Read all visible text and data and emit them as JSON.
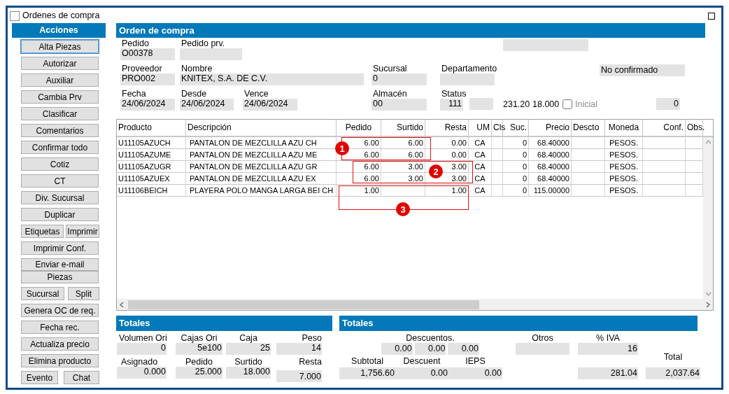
{
  "window": {
    "title": "Ordenes de compra"
  },
  "actions": {
    "title": "Acciones",
    "rows": [
      {
        "kind": "single",
        "buttons": [
          {
            "label": "Alta Piezas",
            "focused": true
          }
        ]
      },
      {
        "kind": "single",
        "buttons": [
          {
            "label": "Autorizar",
            "focused": false
          }
        ]
      },
      {
        "kind": "single",
        "buttons": [
          {
            "label": "Auxiliar",
            "focused": false
          }
        ]
      },
      {
        "kind": "single",
        "buttons": [
          {
            "label": "Cambia Prv",
            "focused": false
          }
        ]
      },
      {
        "kind": "single",
        "buttons": [
          {
            "label": "Clasificar",
            "focused": false
          }
        ]
      },
      {
        "kind": "single",
        "buttons": [
          {
            "label": "Comentarios",
            "focused": false
          }
        ]
      },
      {
        "kind": "single",
        "buttons": [
          {
            "label": "Confirmar todo",
            "focused": false
          }
        ]
      },
      {
        "kind": "single",
        "buttons": [
          {
            "label": "Cotiz",
            "focused": false
          }
        ]
      },
      {
        "kind": "single",
        "buttons": [
          {
            "label": "CT",
            "focused": false
          }
        ]
      },
      {
        "kind": "single",
        "buttons": [
          {
            "label": "Div. Sucursal",
            "focused": false
          }
        ]
      },
      {
        "kind": "single",
        "buttons": [
          {
            "label": "Duplicar",
            "focused": false
          }
        ]
      },
      {
        "kind": "pair",
        "buttons": [
          {
            "label": "Etiquetas",
            "focused": false
          },
          {
            "label": "Imprimir",
            "focused": false
          }
        ]
      },
      {
        "kind": "single",
        "buttons": [
          {
            "label": "Imprimir Conf.",
            "focused": false
          }
        ]
      },
      {
        "kind": "stack",
        "buttons": [
          {
            "label": "Enviar e-mail",
            "focused": false
          },
          {
            "label": "Piezas",
            "focused": false
          }
        ]
      },
      {
        "kind": "pair",
        "buttons": [
          {
            "label": "Sucursal",
            "focused": false
          },
          {
            "label": "Split",
            "focused": false
          }
        ]
      },
      {
        "kind": "single",
        "buttons": [
          {
            "label": "Genera OC de req.",
            "focused": false
          }
        ]
      },
      {
        "kind": "single",
        "buttons": [
          {
            "label": "Fecha rec.",
            "focused": false
          }
        ]
      },
      {
        "kind": "single",
        "buttons": [
          {
            "label": "Actualiza precio",
            "focused": false
          }
        ]
      },
      {
        "kind": "single",
        "buttons": [
          {
            "label": "Elimina producto",
            "focused": false
          }
        ]
      },
      {
        "kind": "pair",
        "buttons": [
          {
            "label": "Evento",
            "focused": false
          },
          {
            "label": "Chat",
            "focused": false
          }
        ]
      }
    ]
  },
  "order": {
    "title": "Orden de compra",
    "rows": [
      {
        "items": [
          {
            "kind": "field",
            "label": "Pedido",
            "value": "O00378"
          },
          {
            "kind": "field",
            "label": "Pedido prv."
          },
          {
            "kind": "box"
          }
        ]
      },
      {
        "items": [
          {
            "kind": "field",
            "label": "Proveedor",
            "value": "PRO002"
          },
          {
            "kind": "field",
            "label": "Nombre",
            "value": "KNITEX, S.A. DE C.V."
          },
          {
            "kind": "field",
            "label": "Sucursal",
            "value": "0"
          },
          {
            "kind": "field",
            "label": "Departamento"
          },
          {
            "kind": "box",
            "value": "No confirmado"
          }
        ]
      },
      {
        "items": [
          {
            "kind": "field",
            "label": "Fecha",
            "value": "24/06/2024"
          },
          {
            "kind": "field",
            "label": "Desde",
            "value": "24/06/2024"
          },
          {
            "kind": "field",
            "label": "Vence",
            "value": "24/06/2024"
          },
          {
            "kind": "field",
            "label": "Almacén",
            "value": "00"
          },
          {
            "kind": "field",
            "label": "Status",
            "value": "111"
          },
          {
            "kind": "box"
          },
          {
            "kind": "text",
            "value": "231.20"
          },
          {
            "kind": "text",
            "value": "18.000"
          },
          {
            "kind": "checkbox",
            "label": "Inicial",
            "checked": false
          },
          {
            "kind": "box",
            "value": "0"
          }
        ]
      }
    ]
  },
  "table": {
    "columns": [
      "Producto",
      "Descripción",
      "Pedido",
      "Surtido",
      "Resta",
      "UM",
      "Cls",
      "Suc.",
      "Precio",
      "Descto",
      "Moneda",
      "Conf.",
      "Obs."
    ],
    "rows": [
      [
        "U11105AZUCH",
        "PANTALON DE MEZCLILLA AZU CH",
        "6.00",
        "6.00",
        "0.00",
        "CA",
        null,
        "0",
        "68.40000",
        null,
        "PESOS.",
        null,
        null
      ],
      [
        "U11105AZUME",
        "PANTALON DE MEZCLILLA AZU ME",
        "6.00",
        "6.00",
        "0.00",
        "CA",
        null,
        "0",
        "68.40000",
        null,
        "PESOS.",
        null,
        null
      ],
      [
        "U11105AZUGR",
        "PANTALON DE MEZCLILLA AZU GR",
        "6.00",
        "3.00",
        "3.00",
        "CA",
        null,
        "0",
        "68.40000",
        null,
        "PESOS.",
        null,
        null
      ],
      [
        "U11105AZUEX",
        "PANTALON DE MEZCLILLA AZU EX",
        "6.00",
        "3.00",
        "3.00",
        "CA",
        null,
        "0",
        "68.40000",
        null,
        "PESOS.",
        null,
        null
      ],
      [
        "U11106BEICH",
        "PLAYERA POLO MANGA LARGA BEI CH",
        "1.00",
        null,
        "1.00",
        "CA",
        null,
        "0",
        "115.00000",
        null,
        "PESOS.",
        null,
        null
      ]
    ],
    "annotations": [
      {
        "label": "1"
      },
      {
        "label": "2"
      },
      {
        "label": "3"
      }
    ]
  },
  "totals_left": {
    "title": "Totales",
    "rows": [
      [
        {
          "label": "Volumen Ori",
          "value": "0"
        },
        {
          "label": "Cajas Ori",
          "value": "5e100"
        },
        {
          "label": "Caja",
          "value": "25"
        },
        {
          "label": "Peso",
          "value": "14"
        }
      ],
      [
        {
          "label": "Asignado",
          "value": "0.000"
        },
        {
          "label": "Pedido",
          "value": "25.000"
        },
        {
          "label": "Surtido",
          "value": "18.000"
        },
        {
          "label": "Resta",
          "value": "7.000"
        }
      ]
    ]
  },
  "totals_right": {
    "title": "Totales",
    "discounts": {
      "label": "Descuentos.",
      "values": [
        "0.00",
        "0.00",
        "0.00"
      ]
    },
    "otros": {
      "label": "Otros"
    },
    "iva": {
      "label": "% IVA",
      "value": "16"
    },
    "amounts": [
      {
        "label": "Subtotal",
        "value": "1,756.60"
      },
      {
        "label": "Descuent",
        "value": "0.00"
      },
      {
        "label": "IEPS",
        "value": "0.00"
      }
    ],
    "iva_amount": {
      "value": "281.04"
    },
    "total": {
      "label": "Total",
      "value": "2,037.64"
    }
  }
}
